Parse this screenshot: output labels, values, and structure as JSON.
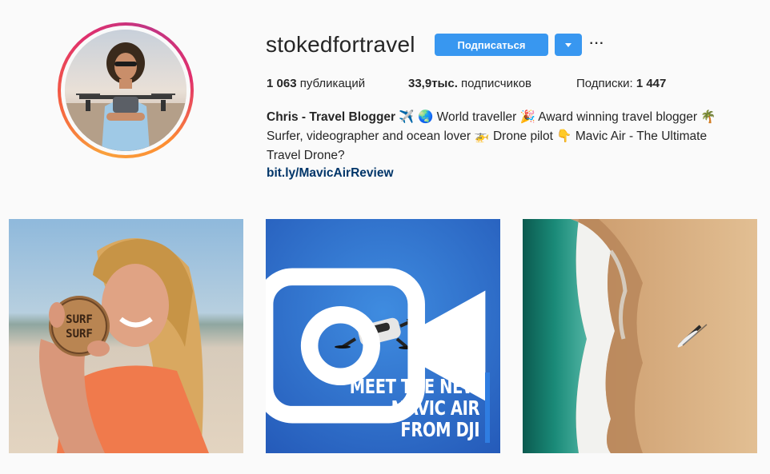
{
  "profile": {
    "username": "stokedfortravel",
    "follow_label": "Подписаться",
    "more_label": "···",
    "stats": {
      "posts_count": "1 063",
      "posts_label": " публикаций",
      "followers_count": "33,9тыс.",
      "followers_label": " подписчиков",
      "following_label": "Подписки: ",
      "following_count": "1 447"
    },
    "bio": {
      "name": "Chris - Travel Blogger",
      "line1_rest": " ✈️ 🌏 World traveller 🎉 Award winning travel blogger 🌴",
      "line2": "Surfer, videographer and ocean lover 🚁 Drone pilot 👇 Mavic Air - The Ultimate",
      "line3": "Travel Drone?",
      "link": "bit.ly/MavicAirReview"
    }
  },
  "posts": [
    {
      "type": "image",
      "disc_text": "SURF SURF"
    },
    {
      "type": "video",
      "icon": "video-camera-icon",
      "overlay_lines": [
        "MEET THE NEW",
        "MAVIC AIR",
        "FROM DJI"
      ]
    },
    {
      "type": "image"
    }
  ],
  "colors": {
    "accent": "#3897f0",
    "link": "#003569",
    "ring": [
      "#f9a03c",
      "#e1306c",
      "#c13584"
    ]
  }
}
